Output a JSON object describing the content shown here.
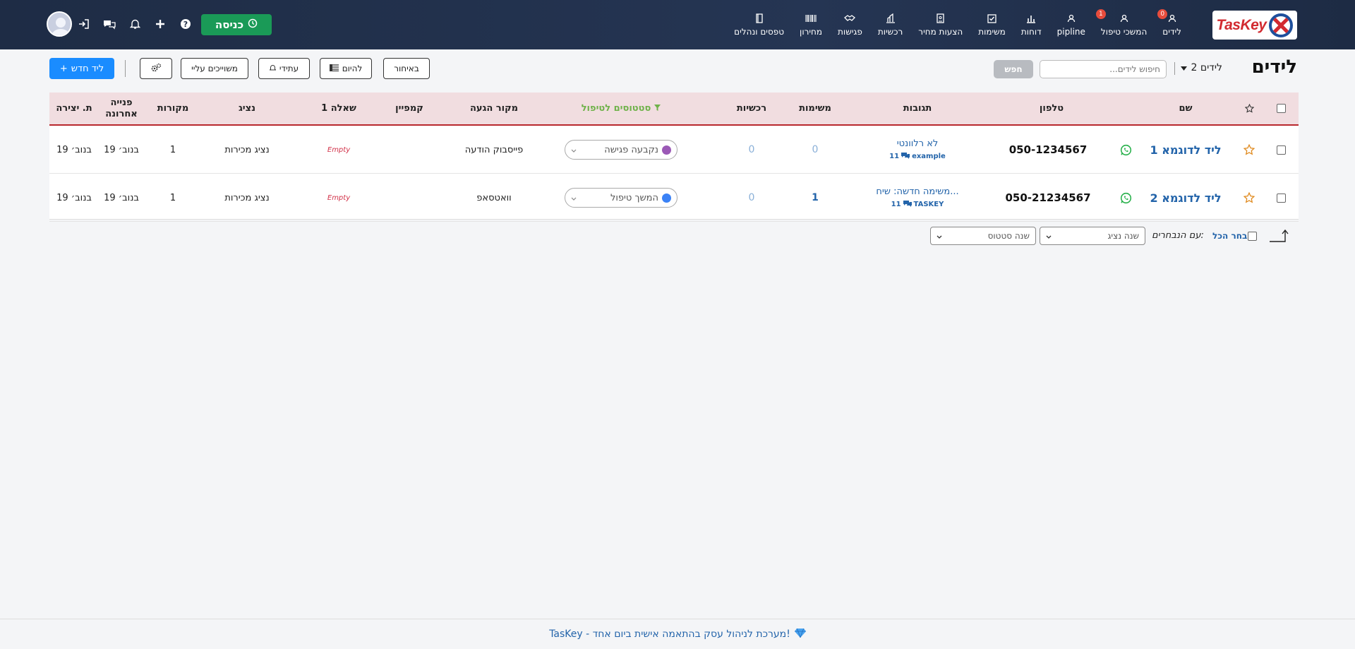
{
  "nav": {
    "logo_text": "TasKey",
    "items": [
      {
        "label": "לידים",
        "icon": "user-icon",
        "badge": "0"
      },
      {
        "label": "המשכי טיפול",
        "icon": "user-icon",
        "badge": "1"
      },
      {
        "label": "pipline",
        "icon": "user-icon",
        "badge": ""
      },
      {
        "label": "דוחות",
        "icon": "bar-chart-icon",
        "badge": ""
      },
      {
        "label": "משימות",
        "icon": "checkbox-icon",
        "badge": ""
      },
      {
        "label": "הצעות מחיר",
        "icon": "document-icon",
        "badge": ""
      },
      {
        "label": "רכשיות",
        "icon": "cart-icon",
        "badge": ""
      },
      {
        "label": "פגישות",
        "icon": "handshake-icon",
        "badge": ""
      },
      {
        "label": "מחירון",
        "icon": "barcode-icon",
        "badge": ""
      },
      {
        "label": "טפסים ונהלים",
        "icon": "book-icon",
        "badge": ""
      }
    ],
    "enter_label": "כניסה"
  },
  "toolbar": {
    "title": "לידים",
    "leads_count": "2 לידים",
    "search_placeholder": "חיפוש לידים...",
    "search_button": "חפש",
    "new_lead": "ליד חדש",
    "buttons": {
      "late": "באיחור",
      "today": "להיום",
      "future": "עתידי",
      "assigned": "משוייכים עליי"
    }
  },
  "table": {
    "headers": {
      "name": "שם",
      "phone": "טלפון",
      "replies": "תגובות",
      "tasks": "משימות",
      "purchases": "רכשיות",
      "status": "סטטוסים לטיפול",
      "source": "מקור הגעה",
      "campaign": "קמפיין",
      "question": "שאלה 1",
      "rep": "נציג",
      "sources": "מקורות",
      "last_contact_1": "פנייה",
      "last_contact_2": "אחרונה",
      "created": "ת. יצירה"
    },
    "rows": [
      {
        "name": "ליד לדוגמא 1",
        "phone": "050-1234567",
        "reply_text": "לא רלוונטי",
        "reply_count": "11",
        "reply_user": "example",
        "tasks": "0",
        "purchases": "0",
        "status": "נקבעה פגישה",
        "status_color": "#9b59b6",
        "source": "פייסבוק הודעה",
        "campaign": "",
        "question": "Empty",
        "rep": "נציג מכירות",
        "sources": "1",
        "last_contact": "19 בנוב׳",
        "created": "19 בנוב׳"
      },
      {
        "name": "ליד לדוגמא 2",
        "phone": "050-21234567",
        "reply_text": "משימה חדשה: שיח...",
        "reply_count": "11",
        "reply_user": "TASKEY",
        "tasks": "1",
        "purchases": "0",
        "status": "המשך טיפול",
        "status_color": "#3b82f6",
        "source": "וואטסאפ",
        "campaign": "",
        "question": "Empty",
        "rep": "נציג מכירות",
        "sources": "1",
        "last_contact": "19 בנוב׳",
        "created": "19 בנוב׳"
      }
    ]
  },
  "bulk": {
    "select_all": "בחר הכל",
    "with_selected": "עם הנבחרים:",
    "change_rep": "שנה נציג",
    "change_status": "שנה סטטוס"
  },
  "footer": {
    "text": "TasKey - מערכת לניהול עסק בהתאמה אישית ביום אחד!"
  },
  "colors": {
    "navbar": "#1e2c45",
    "accent_blue": "#1a8cff",
    "enter_green": "#1a9a57",
    "header_row": "#f1dde0",
    "header_line": "#b9272d"
  }
}
